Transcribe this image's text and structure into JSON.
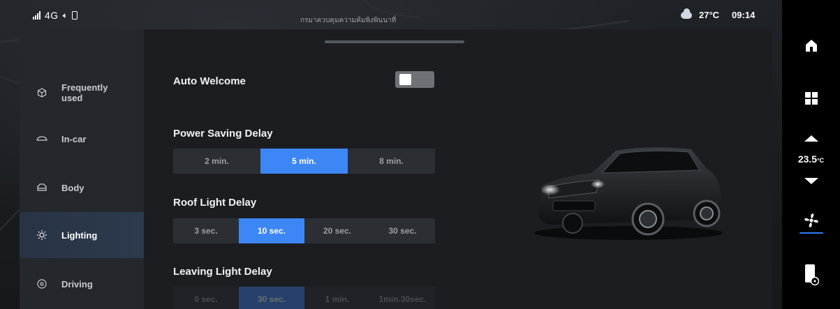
{
  "statusbar": {
    "network": "4G",
    "road_name": "กรมาควบคุมความค้มพิงพินนาที่",
    "temperature": "27°C",
    "time": "09:14"
  },
  "sidebar": {
    "items": [
      {
        "label": "Frequently\nused",
        "icon": "cube-icon"
      },
      {
        "label": "In-car",
        "icon": "car-outline-icon"
      },
      {
        "label": "Body",
        "icon": "car-body-icon"
      },
      {
        "label": "Lighting",
        "icon": "sun-icon",
        "active": true
      },
      {
        "label": "Driving",
        "icon": "steering-wheel-icon"
      }
    ]
  },
  "settings": {
    "auto_welcome": {
      "label": "Auto Welcome",
      "enabled": true
    },
    "power_saving": {
      "label": "Power Saving Delay",
      "options": [
        "2 min.",
        "5 min.",
        "8 min."
      ],
      "selected": "5 min."
    },
    "roof_light": {
      "label": "Roof Light Delay",
      "options": [
        "3 sec.",
        "10 sec.",
        "20 sec.",
        "30 sec."
      ],
      "selected": "10 sec."
    },
    "leaving_light": {
      "label": "Leaving Light Delay",
      "options": [
        "0 sec.",
        "30 sec.",
        "1 min.",
        "1min.30sec."
      ],
      "selected": "30 sec."
    }
  },
  "rail": {
    "temperature": "23.5",
    "temperature_unit": "°C",
    "icons": [
      "home-icon",
      "apps-grid-icon",
      "chevron-up-icon",
      "chevron-down-icon",
      "fan-icon",
      "phone-icon"
    ]
  },
  "colors": {
    "accent": "#3d86f5",
    "background": "#1b1d21"
  }
}
